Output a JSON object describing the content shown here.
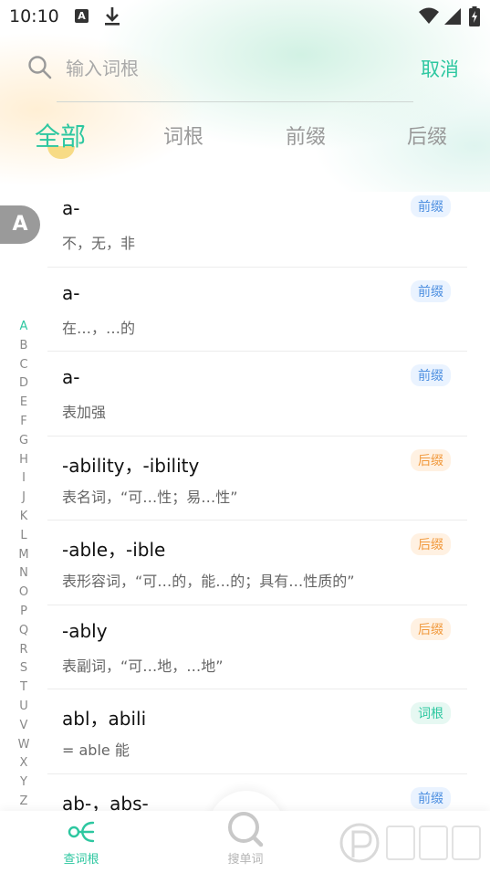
{
  "status_bar": {
    "time": "10:10",
    "icons": [
      "a-notification-icon",
      "download-icon",
      "wifi-icon",
      "signal-icon",
      "battery-icon"
    ]
  },
  "search": {
    "placeholder": "输入词根",
    "value": "",
    "cancel_label": "取消"
  },
  "tabs": [
    {
      "label": "全部",
      "active": true
    },
    {
      "label": "词根",
      "active": false
    },
    {
      "label": "前缀",
      "active": false
    },
    {
      "label": "后缀",
      "active": false
    }
  ],
  "current_letter": "A",
  "index_letters": [
    "A",
    "B",
    "C",
    "D",
    "E",
    "F",
    "G",
    "H",
    "I",
    "J",
    "K",
    "L",
    "M",
    "N",
    "O",
    "P",
    "Q",
    "R",
    "S",
    "T",
    "U",
    "V",
    "W",
    "X",
    "Y",
    "Z"
  ],
  "entries": [
    {
      "title": "a-",
      "meaning": "不，无，非",
      "tag": "前缀",
      "kind": "prefix"
    },
    {
      "title": "a-",
      "meaning": "在…，…的",
      "tag": "前缀",
      "kind": "prefix"
    },
    {
      "title": "a-",
      "meaning": "表加强",
      "tag": "前缀",
      "kind": "prefix"
    },
    {
      "title": "-ability，-ibility",
      "meaning": "表名词，“可…性；易…性”",
      "tag": "后缀",
      "kind": "suffix"
    },
    {
      "title": "-able，-ible",
      "meaning": "表形容词，“可…的，能…的；具有…性质的”",
      "tag": "后缀",
      "kind": "suffix"
    },
    {
      "title": "-ably",
      "meaning": "表副词，“可…地，…地”",
      "tag": "后缀",
      "kind": "suffix"
    },
    {
      "title": "abl，abili",
      "meaning": "= able 能",
      "tag": "词根",
      "kind": "root"
    },
    {
      "title": "ab-，abs-",
      "meaning": "",
      "tag": "前缀",
      "kind": "prefix"
    }
  ],
  "bottom_nav": [
    {
      "label": "查词根",
      "icon": "root-tree-icon",
      "active": true
    },
    {
      "label": "搜单词",
      "icon": "search-word-icon",
      "active": false
    }
  ],
  "colors": {
    "accent": "#2dc7a0",
    "prefix_badge": "#4d8fe0",
    "suffix_badge": "#f19a3e",
    "root_badge": "#2dc7a0"
  }
}
